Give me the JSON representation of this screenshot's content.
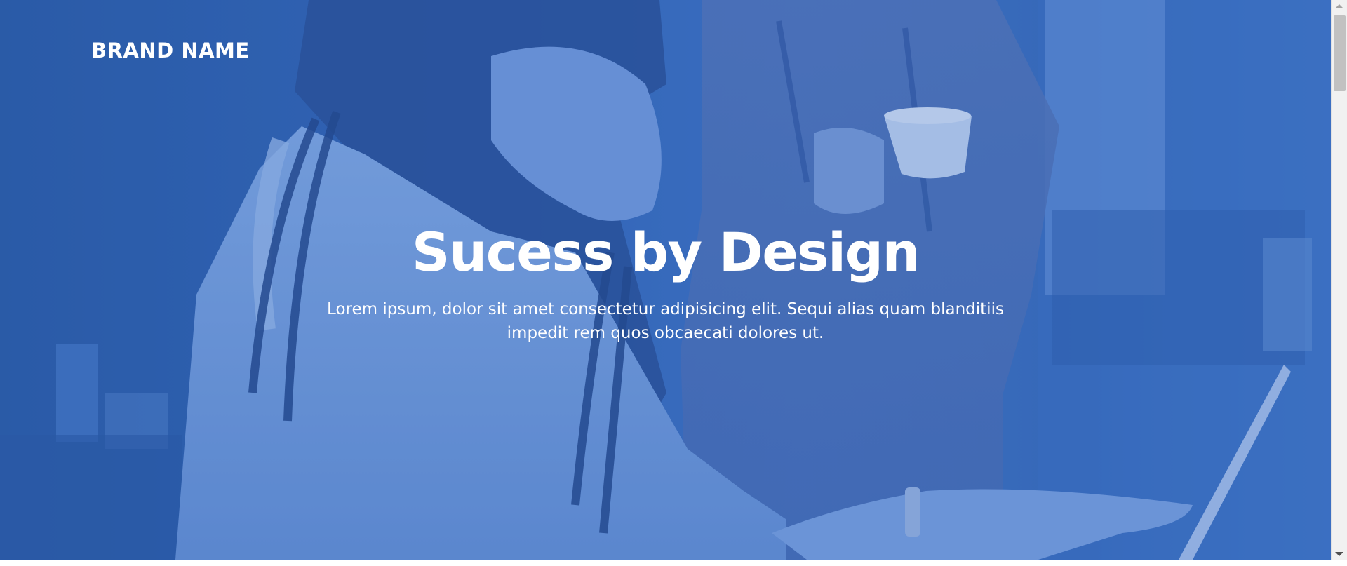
{
  "brand": {
    "name": "BRAND NAME"
  },
  "hero": {
    "title": "Sucess by Design",
    "text": "Lorem ipsum, dolor sit amet consectetur adipisicing elit. Sequi alias quam blanditiis impedit rem quos obcaecati dolores ut."
  },
  "colors": {
    "overlay": "#3566b3",
    "text": "#ffffff"
  },
  "icons": {
    "scroll_up": "triangle-up-icon",
    "scroll_down": "triangle-down-icon"
  }
}
